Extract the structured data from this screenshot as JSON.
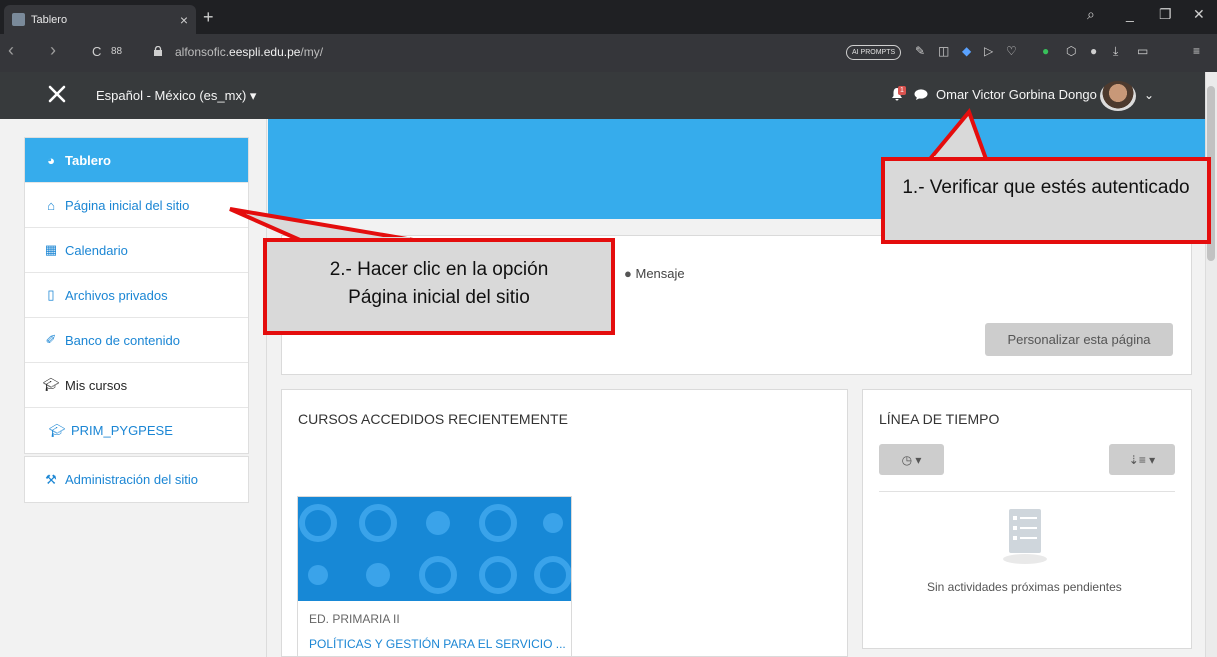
{
  "browser": {
    "tab_title": "Tablero",
    "tab_close": "×",
    "new_tab": "+",
    "url_host": "alfonsofic.eespli.edu.pe/my/",
    "url_prefix": "alfonsofic.",
    "url_domain": "eespli.edu.pe",
    "url_path": "/my/",
    "ai_prompts_label": "AI PROMPTS",
    "search_glyph": "⌕",
    "minimize_glyph": "_",
    "maximize_glyph": "❐",
    "close_glyph": "✕",
    "back_glyph": "‹",
    "forward_glyph": "›",
    "reload_glyph": "C",
    "apps_glyph": "88"
  },
  "navbar": {
    "language": "Español - México (es_mx) ▾",
    "user_name": "Omar Victor Gorbina Dongo",
    "notification_count": "1",
    "user_caret": "⌄"
  },
  "sidebar": {
    "items": [
      {
        "label": "Tablero",
        "icon": "dashboard-icon"
      },
      {
        "label": "Página inicial del sitio",
        "icon": "home-icon"
      },
      {
        "label": "Calendario",
        "icon": "calendar-icon"
      },
      {
        "label": "Archivos privados",
        "icon": "file-icon"
      },
      {
        "label": "Banco de contenido",
        "icon": "paint-brush-icon"
      },
      {
        "label": "Mis cursos",
        "icon": "graduation-cap-icon"
      },
      {
        "label": "PRIM_PYGPESE",
        "icon": "graduation-cap-icon"
      }
    ],
    "admin": {
      "label": "Administración del sitio",
      "icon": "wrench-icon"
    }
  },
  "main": {
    "message_label": "Mensaje",
    "customize_button": "Personalizar esta página",
    "recent_courses_title": "CURSOS ACCEDIDOS RECIENTEMENTE",
    "course_category": "ED. PRIMARIA II",
    "course_name": "POLÍTICAS Y GESTIÓN PARA EL SERVICIO ...",
    "timeline_title": "LÍNEA DE TIEMPO",
    "timeline_empty": "Sin actividades próximas pendientes"
  },
  "callouts": {
    "step1": "1.- Verificar que estés autenticado",
    "step2_line1": "2.- Hacer clic en la opción",
    "step2_line2": "Página inicial del sitio"
  },
  "colors": {
    "accent_blue": "#36acec",
    "link_blue": "#1b86d4",
    "navbar": "#373a3c",
    "callout_border": "#e40d0d",
    "callout_fill": "#d9d9d9"
  }
}
